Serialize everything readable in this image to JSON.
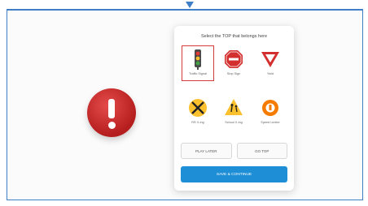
{
  "prompt": "Select the TOP that belongs here",
  "alert": {
    "icon": "exclamation-icon",
    "color": "#c62828"
  },
  "options": [
    {
      "label": "Traffic Signal",
      "icon": "traffic-light-icon",
      "selected": true
    },
    {
      "label": "Stop Sign",
      "icon": "stop-sign-icon",
      "selected": false
    },
    {
      "label": "Yield",
      "icon": "yield-sign-icon",
      "selected": false
    },
    {
      "label": "RR X-ing",
      "icon": "railroad-crossing-icon",
      "selected": false
    },
    {
      "label": "School X-ing",
      "icon": "school-crossing-icon",
      "selected": false
    },
    {
      "label": "Speed Limiter",
      "icon": "speed-sign-icon",
      "selected": false
    }
  ],
  "buttons": {
    "play_later": "PLAY LATER",
    "go_top": "GO TOP",
    "save_continue": "SAVE & CONTINUE"
  },
  "colors": {
    "accent": "#1e8fd6",
    "frame": "#3f7fc7",
    "selected": "#d43a3a"
  }
}
